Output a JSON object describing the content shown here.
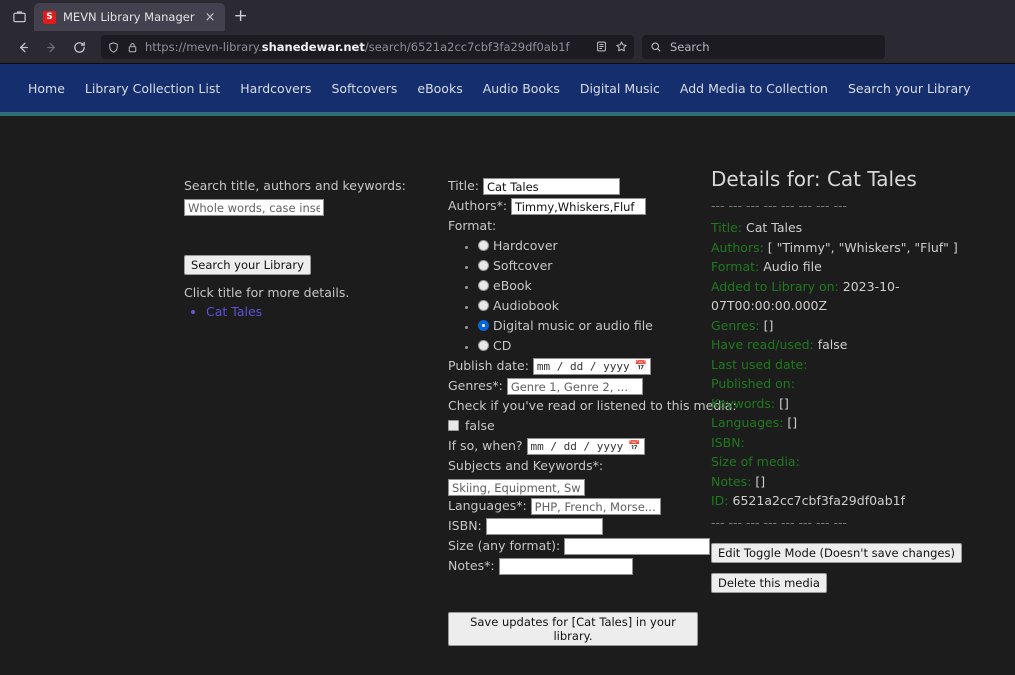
{
  "browser": {
    "tab": {
      "title": "MEVN Library Manager",
      "favicon_letter": "S",
      "close_label": "×"
    },
    "newtab_label": "+",
    "url_prefix": "https://mevn-library.",
    "url_domain": "shanedewar.net",
    "url_suffix": "/search/6521a2cc7cbf3fa29df0ab1f",
    "search_placeholder": "Search"
  },
  "sitenav": {
    "items": [
      {
        "label": "Home",
        "name": "nav-home"
      },
      {
        "label": "Library Collection List",
        "name": "nav-library-collection-list"
      },
      {
        "label": "Hardcovers",
        "name": "nav-hardcovers"
      },
      {
        "label": "Softcovers",
        "name": "nav-softcovers"
      },
      {
        "label": "eBooks",
        "name": "nav-ebooks"
      },
      {
        "label": "Audio Books",
        "name": "nav-audio-books"
      },
      {
        "label": "Digital Music",
        "name": "nav-digital-music"
      },
      {
        "label": "Add Media to Collection",
        "name": "nav-add-media-to-collection"
      },
      {
        "label": "Search your Library",
        "name": "nav-search-your-library"
      }
    ]
  },
  "search_panel": {
    "heading": "Search title, authors and keywords:",
    "input_placeholder": "Whole words, case insensitive",
    "input_value": "",
    "button_label": "Search your Library",
    "hint": "Click title for more details.",
    "results": [
      {
        "label": "Cat Tales"
      }
    ]
  },
  "form": {
    "title_label": "Title:",
    "title_value": "Cat Tales",
    "authors_label": "Authors*:",
    "authors_value": "Timmy,Whiskers,Fluf",
    "format_label": "Format:",
    "formats": [
      {
        "label": "Hardcover",
        "checked": false
      },
      {
        "label": "Softcover",
        "checked": false
      },
      {
        "label": "eBook",
        "checked": false
      },
      {
        "label": "Audiobook",
        "checked": false
      },
      {
        "label": "Digital music or audio file",
        "checked": true
      },
      {
        "label": "CD",
        "checked": false
      }
    ],
    "publish_date_label": "Publish date:",
    "publish_date_value": "mm / dd / yyyy",
    "genres_label": "Genres*:",
    "genres_placeholder": "Genre 1, Genre 2, ...",
    "genres_value": "",
    "read_check_label": "Check if you've read or listened to this media:",
    "read_checkbox_label": "false",
    "read_checked": false,
    "if_so_when_label": "If so, when?",
    "if_so_when_value": "mm / dd / yyyy",
    "subjects_label": "Subjects and Keywords*:",
    "subjects_placeholder": "Skiing, Equipment, Switzerland...",
    "subjects_value": "",
    "languages_label": "Languages*:",
    "languages_placeholder": "PHP, French, Morse...",
    "languages_value": "",
    "isbn_label": "ISBN:",
    "isbn_value": "",
    "size_label": "Size (any format):",
    "size_value": "",
    "notes_label": "Notes*:",
    "notes_value": "",
    "save_button_label": "Save updates for [Cat Tales] in your library."
  },
  "details": {
    "heading": "Details for: Cat Tales",
    "divider": "--- --- --- --- --- --- --- ---",
    "rows": [
      {
        "key": "Title:",
        "value": "Cat Tales"
      },
      {
        "key": "Authors:",
        "value": "[ \"Timmy\", \"Whiskers\", \"Fluf\" ]"
      },
      {
        "key": "Format:",
        "value": "Audio file"
      },
      {
        "key": "Added to Library on:",
        "value": "2023-10-07T00:00:00.000Z"
      },
      {
        "key": "Genres:",
        "value": "[]"
      },
      {
        "key": "Have read/used:",
        "value": "false"
      },
      {
        "key": "Last used date:",
        "value": ""
      },
      {
        "key": "Published on:",
        "value": ""
      },
      {
        "key": "Keywords:",
        "value": "[]"
      },
      {
        "key": "Languages:",
        "value": "[]"
      },
      {
        "key": "ISBN:",
        "value": ""
      },
      {
        "key": "Size of media:",
        "value": ""
      },
      {
        "key": "Notes:",
        "value": "[]"
      },
      {
        "key": "ID:",
        "value": "6521a2cc7cbf3fa29df0ab1f"
      }
    ],
    "edit_button_label": "Edit Toggle Mode (Doesn't save changes)",
    "delete_button_label": "Delete this media"
  },
  "colors": {
    "nav_bg": "#152f6e",
    "nav_border": "#2f6d78",
    "page_bg": "#1c1c1c",
    "detail_key": "#1f7a1f",
    "link": "#5b52d8",
    "radio_checked": "#0a66d6",
    "favicon_bg": "#e31b1b"
  }
}
